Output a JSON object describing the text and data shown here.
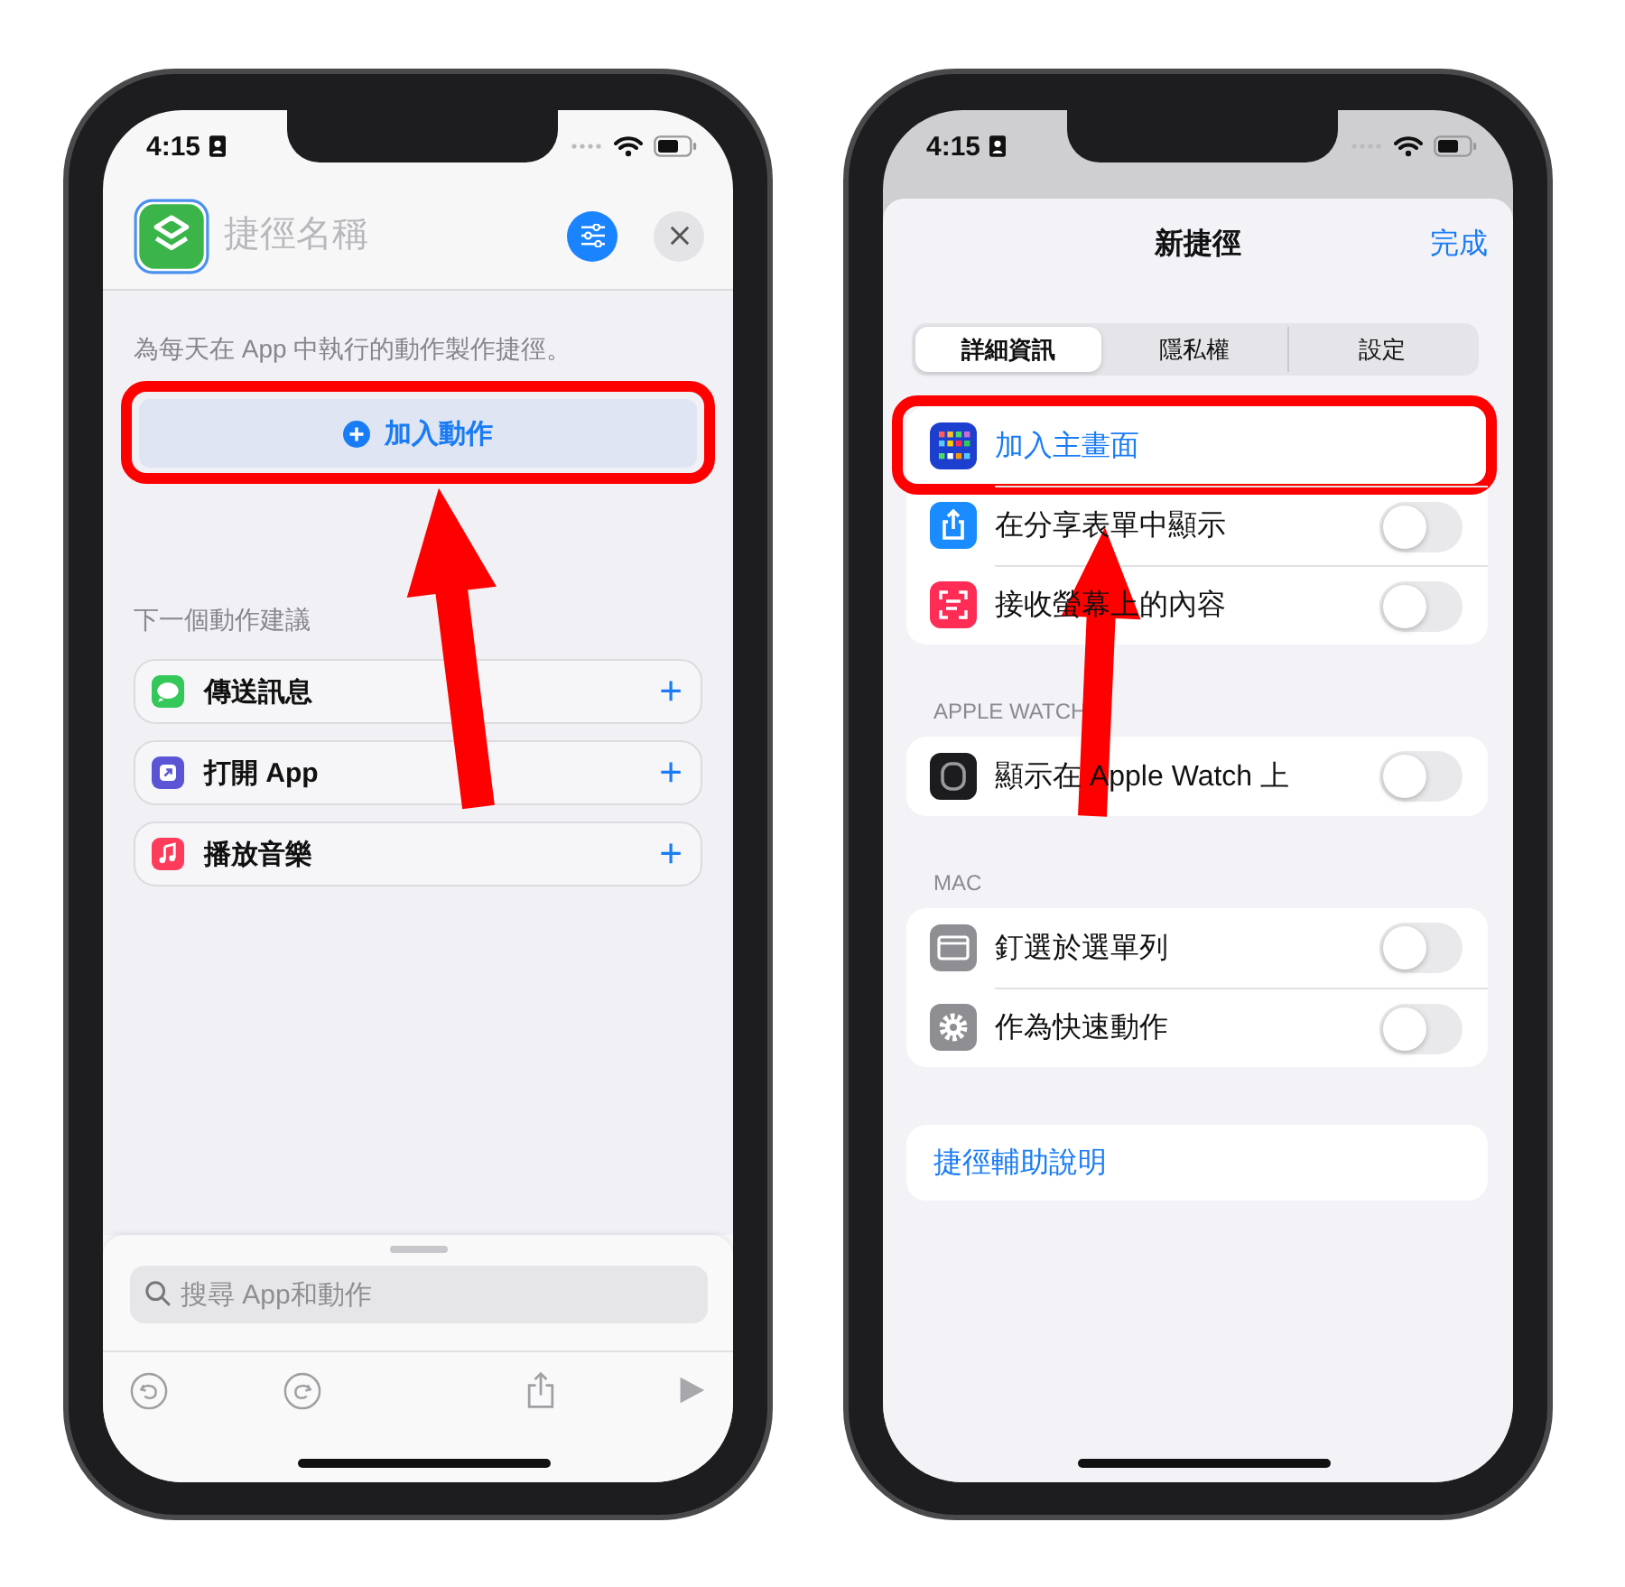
{
  "phones": [
    {
      "kind": "editor",
      "status_bar": {
        "time": "4:15"
      },
      "header": {
        "name_field": {
          "placeholder": "捷徑名稱"
        }
      },
      "description": "為每天在 App 中執行的動作製作捷徑。",
      "add_button": {
        "label": "加入動作",
        "highlighted": true
      },
      "suggestions_title": "下一個動作建議",
      "suggestions": [
        {
          "kind": "messages",
          "label": "傳送訊息",
          "action": "+"
        },
        {
          "kind": "open-app",
          "label": "打開 App",
          "action": "+"
        },
        {
          "kind": "music",
          "label": "播放音樂",
          "action": "+"
        }
      ],
      "search": {
        "placeholder": "搜尋 App和動作"
      }
    },
    {
      "kind": "details",
      "status_bar": {
        "time": "4:15"
      },
      "title": "新捷徑",
      "done": "完成",
      "segments": [
        {
          "label": "詳細資訊",
          "selected": true
        },
        {
          "label": "隱私權",
          "selected": false
        },
        {
          "label": "設定",
          "selected": false
        }
      ],
      "sections": [
        {
          "rows": [
            {
              "kind": "home-screen",
              "label": "加入主畫面",
              "highlighted": true
            },
            {
              "kind": "share",
              "label": "在分享表單中顯示",
              "on": false,
              "highlighted": false
            },
            {
              "kind": "screen-capture",
              "label": "接收螢幕上的內容",
              "on": false,
              "highlighted": false
            }
          ]
        },
        {
          "header": "APPLE WATCH",
          "rows": [
            {
              "kind": "watch",
              "label": "顯示在 Apple Watch 上",
              "on": false,
              "highlighted": false
            }
          ]
        },
        {
          "header": "MAC",
          "rows": [
            {
              "kind": "window",
              "label": "釘選於選單列",
              "on": false,
              "highlighted": false
            },
            {
              "kind": "gear",
              "label": "作為快速動作",
              "on": false,
              "highlighted": false
            }
          ]
        },
        {
          "rows": [
            {
              "kind": "help",
              "label": "捷徑輔助說明",
              "highlighted": false
            }
          ]
        }
      ]
    }
  ]
}
